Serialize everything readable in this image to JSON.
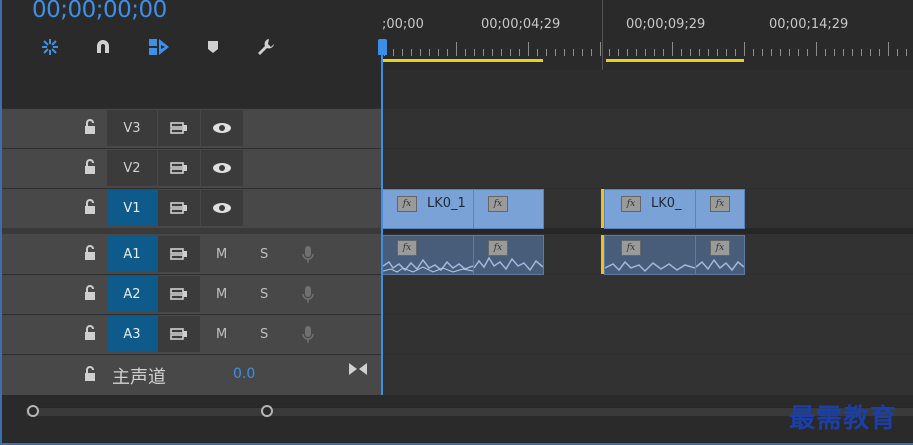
{
  "header": {
    "timecode": "00;00;00;00",
    "tools": [
      "snap-icon",
      "magnet-icon",
      "linked-selection-icon",
      "marker-icon",
      "wrench-icon"
    ]
  },
  "ruler": {
    "labels": [
      ";00;00",
      "00;00;04;29",
      "00;00;09;29",
      "00;00;14;29"
    ]
  },
  "video_tracks": [
    {
      "name": "V3",
      "selected": false
    },
    {
      "name": "V2",
      "selected": false
    },
    {
      "name": "V1",
      "selected": true
    }
  ],
  "audio_tracks": [
    {
      "name": "A1",
      "mute": "M",
      "solo": "S"
    },
    {
      "name": "A2",
      "mute": "M",
      "solo": "S"
    },
    {
      "name": "A3",
      "mute": "M",
      "solo": "S"
    }
  ],
  "master": {
    "label": "主声道",
    "value": "0.0"
  },
  "clips": {
    "v1_a_label": "LK0_1",
    "v1_b_label": "LK0_",
    "fx": "fx"
  },
  "watermark": "最需教育",
  "colors": {
    "accent": "#3f8fe6",
    "selected_track": "#0e5a8a",
    "video_clip": "#7aa2d6",
    "audio_clip": "#485d7a",
    "work_area": "#e6d21a"
  }
}
